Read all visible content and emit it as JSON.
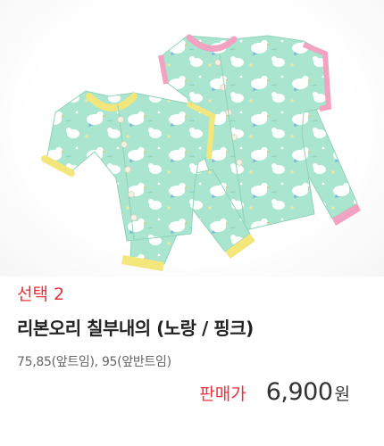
{
  "product": {
    "option_label": "선택 2",
    "name": "리본오리 칠부내의 (노랑 / 핑크)",
    "sizes": "75,85(앞트임), 95(앞반트임)",
    "image_alt": "리본오리 칠부내의 (노랑 / 핑크)"
  },
  "price": {
    "label": "판매가",
    "value": "6,900",
    "unit": "원"
  },
  "colors": {
    "accent": "#e8323c",
    "fabric": "#a8e6cf",
    "trim_yellow": "#f3e67a",
    "trim_pink": "#f2a3c2",
    "text_main": "#222222",
    "text_sub": "#666666"
  }
}
